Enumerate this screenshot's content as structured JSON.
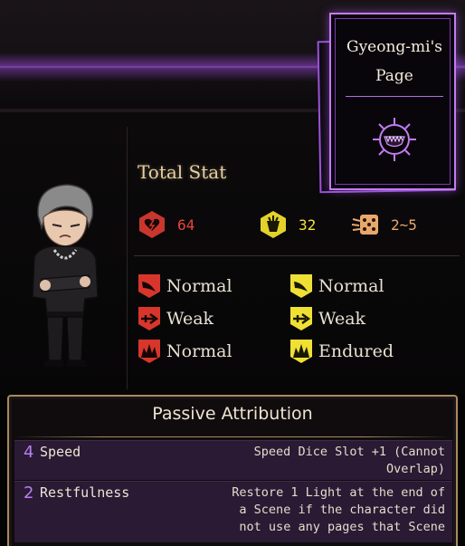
{
  "page": {
    "title": "Gyeong-mi's Page"
  },
  "total_stat": {
    "label": "Total Stat"
  },
  "stats": {
    "hp": {
      "icon": "hp-heart-icon",
      "value": "64",
      "color": "#e8453b"
    },
    "stagger": {
      "icon": "stagger-resist-icon",
      "value": "32",
      "color": "#f2e23a"
    },
    "speed": {
      "icon": "speed-dice-icon",
      "value": "2~5",
      "color": "#e9a86b"
    }
  },
  "resistances": {
    "hp": [
      {
        "type": "slash",
        "icon": "slash-resist-icon",
        "label": "Normal"
      },
      {
        "type": "pierce",
        "icon": "pierce-resist-icon",
        "label": "Weak"
      },
      {
        "type": "blunt",
        "icon": "blunt-resist-icon",
        "label": "Normal"
      }
    ],
    "stagger": [
      {
        "type": "slash",
        "icon": "slash-stagger-icon",
        "label": "Normal"
      },
      {
        "type": "pierce",
        "icon": "pierce-stagger-icon",
        "label": "Weak"
      },
      {
        "type": "blunt",
        "icon": "blunt-stagger-icon",
        "label": "Endured"
      }
    ]
  },
  "passives": {
    "title": "Passive Attribution",
    "items": [
      {
        "cost": "4",
        "name": "Speed",
        "description": "Speed Dice Slot +1 (Cannot Overlap)"
      },
      {
        "cost": "2",
        "name": "Restfulness",
        "description": "Restore 1 Light at the end of a Scene if the character did not use any pages that Scene"
      }
    ]
  },
  "colors": {
    "accent_purple": "#b06be6",
    "hp_red": "#e8453b",
    "stagger_yellow": "#f2e23a",
    "panel_gold": "#a88a5e"
  }
}
